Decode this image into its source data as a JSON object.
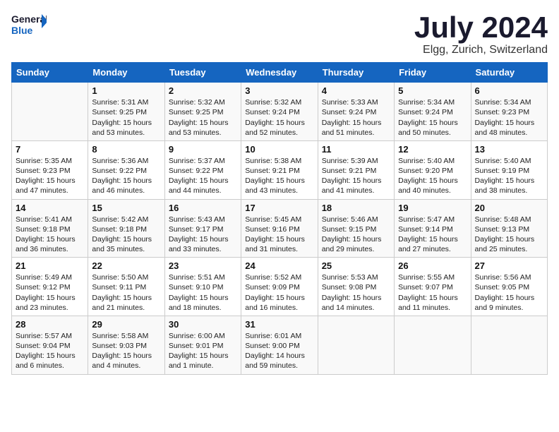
{
  "header": {
    "logo_line1": "General",
    "logo_line2": "Blue",
    "month": "July 2024",
    "location": "Elgg, Zurich, Switzerland"
  },
  "days_of_week": [
    "Sunday",
    "Monday",
    "Tuesday",
    "Wednesday",
    "Thursday",
    "Friday",
    "Saturday"
  ],
  "weeks": [
    [
      {
        "day": "",
        "text": ""
      },
      {
        "day": "1",
        "text": "Sunrise: 5:31 AM\nSunset: 9:25 PM\nDaylight: 15 hours\nand 53 minutes."
      },
      {
        "day": "2",
        "text": "Sunrise: 5:32 AM\nSunset: 9:25 PM\nDaylight: 15 hours\nand 53 minutes."
      },
      {
        "day": "3",
        "text": "Sunrise: 5:32 AM\nSunset: 9:24 PM\nDaylight: 15 hours\nand 52 minutes."
      },
      {
        "day": "4",
        "text": "Sunrise: 5:33 AM\nSunset: 9:24 PM\nDaylight: 15 hours\nand 51 minutes."
      },
      {
        "day": "5",
        "text": "Sunrise: 5:34 AM\nSunset: 9:24 PM\nDaylight: 15 hours\nand 50 minutes."
      },
      {
        "day": "6",
        "text": "Sunrise: 5:34 AM\nSunset: 9:23 PM\nDaylight: 15 hours\nand 48 minutes."
      }
    ],
    [
      {
        "day": "7",
        "text": "Sunrise: 5:35 AM\nSunset: 9:23 PM\nDaylight: 15 hours\nand 47 minutes."
      },
      {
        "day": "8",
        "text": "Sunrise: 5:36 AM\nSunset: 9:22 PM\nDaylight: 15 hours\nand 46 minutes."
      },
      {
        "day": "9",
        "text": "Sunrise: 5:37 AM\nSunset: 9:22 PM\nDaylight: 15 hours\nand 44 minutes."
      },
      {
        "day": "10",
        "text": "Sunrise: 5:38 AM\nSunset: 9:21 PM\nDaylight: 15 hours\nand 43 minutes."
      },
      {
        "day": "11",
        "text": "Sunrise: 5:39 AM\nSunset: 9:21 PM\nDaylight: 15 hours\nand 41 minutes."
      },
      {
        "day": "12",
        "text": "Sunrise: 5:40 AM\nSunset: 9:20 PM\nDaylight: 15 hours\nand 40 minutes."
      },
      {
        "day": "13",
        "text": "Sunrise: 5:40 AM\nSunset: 9:19 PM\nDaylight: 15 hours\nand 38 minutes."
      }
    ],
    [
      {
        "day": "14",
        "text": "Sunrise: 5:41 AM\nSunset: 9:18 PM\nDaylight: 15 hours\nand 36 minutes."
      },
      {
        "day": "15",
        "text": "Sunrise: 5:42 AM\nSunset: 9:18 PM\nDaylight: 15 hours\nand 35 minutes."
      },
      {
        "day": "16",
        "text": "Sunrise: 5:43 AM\nSunset: 9:17 PM\nDaylight: 15 hours\nand 33 minutes."
      },
      {
        "day": "17",
        "text": "Sunrise: 5:45 AM\nSunset: 9:16 PM\nDaylight: 15 hours\nand 31 minutes."
      },
      {
        "day": "18",
        "text": "Sunrise: 5:46 AM\nSunset: 9:15 PM\nDaylight: 15 hours\nand 29 minutes."
      },
      {
        "day": "19",
        "text": "Sunrise: 5:47 AM\nSunset: 9:14 PM\nDaylight: 15 hours\nand 27 minutes."
      },
      {
        "day": "20",
        "text": "Sunrise: 5:48 AM\nSunset: 9:13 PM\nDaylight: 15 hours\nand 25 minutes."
      }
    ],
    [
      {
        "day": "21",
        "text": "Sunrise: 5:49 AM\nSunset: 9:12 PM\nDaylight: 15 hours\nand 23 minutes."
      },
      {
        "day": "22",
        "text": "Sunrise: 5:50 AM\nSunset: 9:11 PM\nDaylight: 15 hours\nand 21 minutes."
      },
      {
        "day": "23",
        "text": "Sunrise: 5:51 AM\nSunset: 9:10 PM\nDaylight: 15 hours\nand 18 minutes."
      },
      {
        "day": "24",
        "text": "Sunrise: 5:52 AM\nSunset: 9:09 PM\nDaylight: 15 hours\nand 16 minutes."
      },
      {
        "day": "25",
        "text": "Sunrise: 5:53 AM\nSunset: 9:08 PM\nDaylight: 15 hours\nand 14 minutes."
      },
      {
        "day": "26",
        "text": "Sunrise: 5:55 AM\nSunset: 9:07 PM\nDaylight: 15 hours\nand 11 minutes."
      },
      {
        "day": "27",
        "text": "Sunrise: 5:56 AM\nSunset: 9:05 PM\nDaylight: 15 hours\nand 9 minutes."
      }
    ],
    [
      {
        "day": "28",
        "text": "Sunrise: 5:57 AM\nSunset: 9:04 PM\nDaylight: 15 hours\nand 6 minutes."
      },
      {
        "day": "29",
        "text": "Sunrise: 5:58 AM\nSunset: 9:03 PM\nDaylight: 15 hours\nand 4 minutes."
      },
      {
        "day": "30",
        "text": "Sunrise: 6:00 AM\nSunset: 9:01 PM\nDaylight: 15 hours\nand 1 minute."
      },
      {
        "day": "31",
        "text": "Sunrise: 6:01 AM\nSunset: 9:00 PM\nDaylight: 14 hours\nand 59 minutes."
      },
      {
        "day": "",
        "text": ""
      },
      {
        "day": "",
        "text": ""
      },
      {
        "day": "",
        "text": ""
      }
    ]
  ]
}
